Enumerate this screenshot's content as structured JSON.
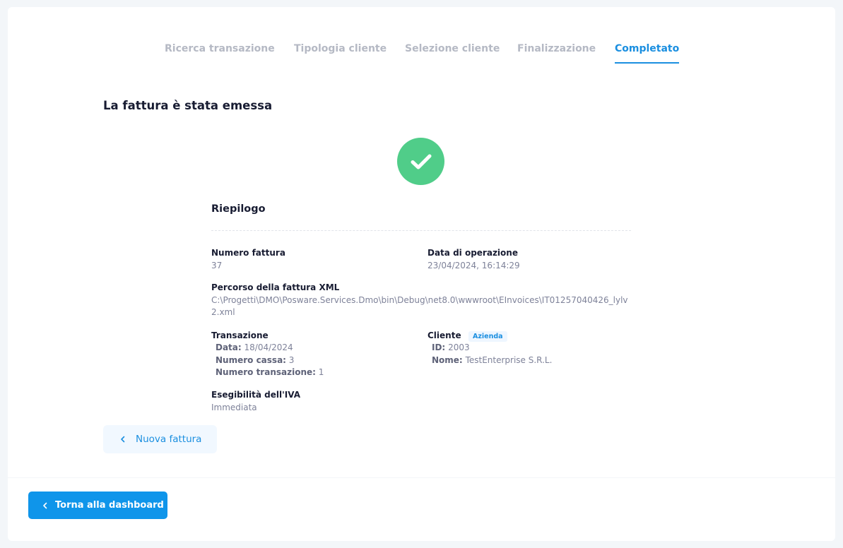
{
  "steps": [
    {
      "label": "Ricerca transazione",
      "active": false
    },
    {
      "label": "Tipologia cliente",
      "active": false
    },
    {
      "label": "Selezione cliente",
      "active": false
    },
    {
      "label": "Finalizzazione",
      "active": false
    },
    {
      "label": "Completato",
      "active": true
    }
  ],
  "page_title": "La fattura è stata emessa",
  "success_icon": "check-circle-icon",
  "colors": {
    "accent": "#1b8fe0",
    "success": "#50cd89",
    "primary_button": "#0f95ea"
  },
  "summary": {
    "title": "Riepilogo",
    "invoice_number_label": "Numero fattura",
    "invoice_number": "37",
    "operation_date_label": "Data di operazione",
    "operation_date": "23/04/2024, 16:14:29",
    "xml_path_label": "Percorso della fattura XML",
    "xml_path": "C:\\Progetti\\DMO\\Posware.Services.Dmo\\bin\\Debug\\net8.0\\wwwroot\\EInvoices\\IT01257040426_lylv2.xml",
    "transaction": {
      "label": "Transazione",
      "date_label": "Data:",
      "date": "18/04/2024",
      "register_label": "Numero cassa:",
      "register": "3",
      "number_label": "Numero transazione:",
      "number": "1"
    },
    "customer": {
      "label": "Cliente",
      "badge": "Azienda",
      "id_label": "ID:",
      "id": "2003",
      "name_label": "Nome:",
      "name": "TestEnterprise S.R.L."
    },
    "vat_label": "Esegibilità dell'IVA",
    "vat_value": "Immediata"
  },
  "buttons": {
    "new_invoice": "Nuova fattura",
    "back_dashboard": "Torna alla dashboard"
  }
}
